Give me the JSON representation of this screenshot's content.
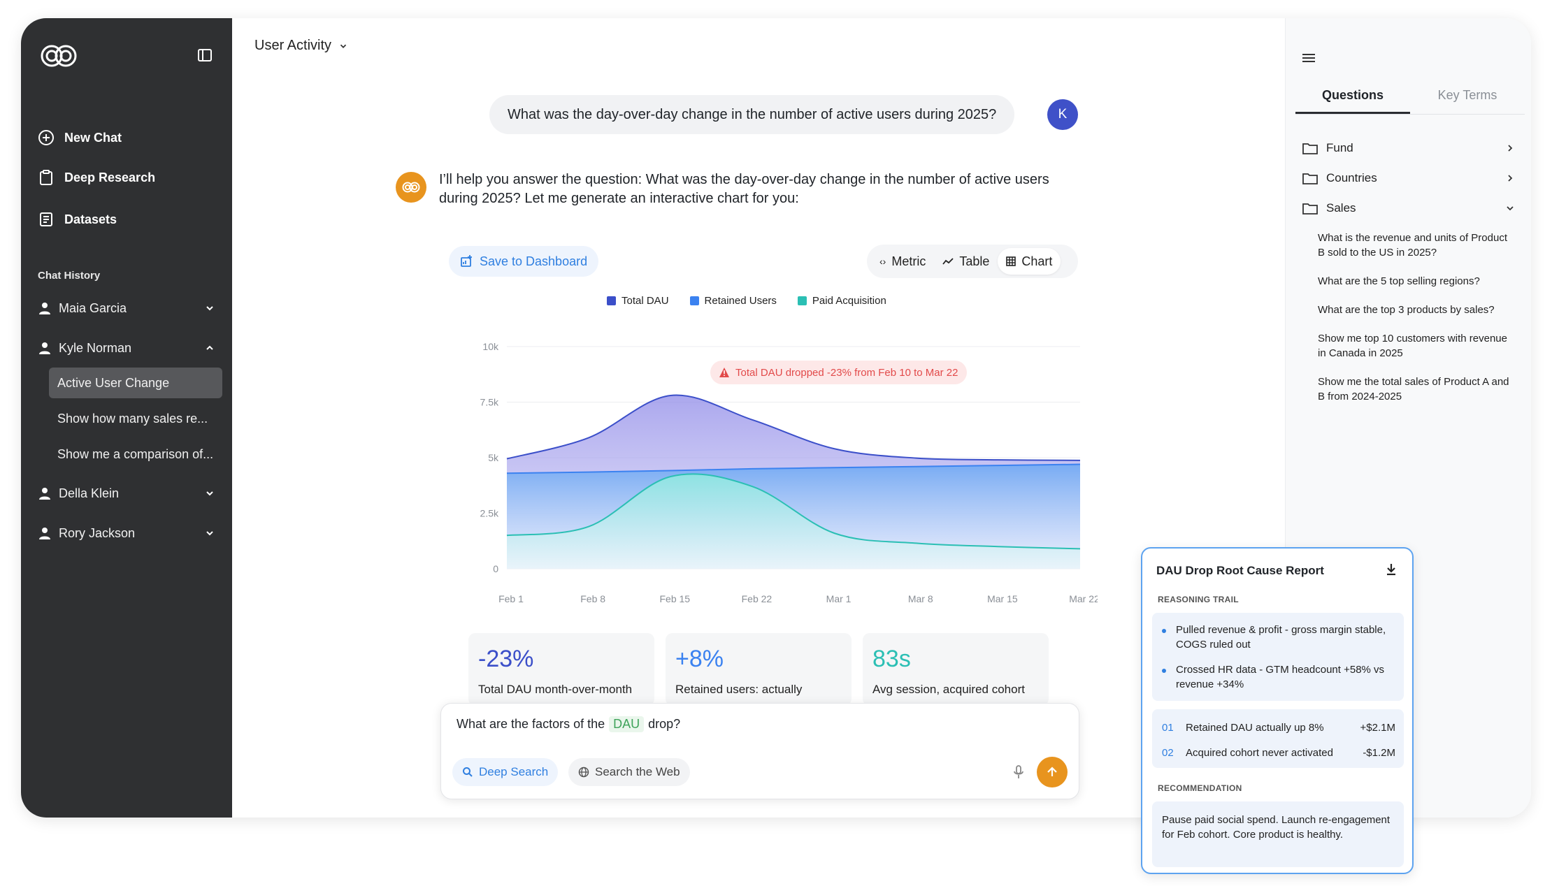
{
  "sidebar": {
    "nav": [
      {
        "label": "New Chat"
      },
      {
        "label": "Deep Research"
      },
      {
        "label": "Datasets"
      }
    ],
    "history_title": "Chat History",
    "users": [
      {
        "name": "Maia Garcia"
      },
      {
        "name": "Kyle Norman"
      },
      {
        "name": "Della Klein"
      },
      {
        "name": "Rory Jackson"
      }
    ],
    "kyle_chats": [
      {
        "label": "Active User Change"
      },
      {
        "label": "Show how many sales re..."
      },
      {
        "label": "Show me a comparison of..."
      }
    ]
  },
  "header": {
    "title": "User Activity"
  },
  "chat": {
    "user_message": "What was the day-over-day change in the number of active users during 2025?",
    "user_avatar": "K",
    "bot_message": "I’ll help you answer the question: What was the day-over-day change in the number of active users during 2025? Let me generate an interactive chart for you:"
  },
  "toolbar": {
    "save_label": "Save to Dashboard",
    "views": [
      {
        "label": "Metric"
      },
      {
        "label": "Table"
      },
      {
        "label": "Chart"
      }
    ],
    "selected_view": "Chart"
  },
  "alert": {
    "text": "Total DAU dropped -23% from Feb 10 to Mar 22"
  },
  "chart_data": {
    "type": "area",
    "x": [
      "Feb 1",
      "Feb 8",
      "Feb 15",
      "Feb 22",
      "Mar 1",
      "Mar 8",
      "Mar 15",
      "Mar 22"
    ],
    "ylim": [
      0,
      10000
    ],
    "yticks": [
      "10k",
      "7.5k",
      "5k",
      "2.5k",
      "0"
    ],
    "legend_position": "top-center",
    "grid": true,
    "series": [
      {
        "name": "Total DAU",
        "color": "#3b4fc9",
        "values": [
          4950,
          5900,
          7800,
          6700,
          5400,
          4980,
          4900,
          4880
        ]
      },
      {
        "name": "Retained Users",
        "color": "#3b82f0",
        "values": [
          4300,
          4350,
          4420,
          4500,
          4550,
          4600,
          4650,
          4700
        ]
      },
      {
        "name": "Paid Acquisition",
        "color": "#2bbfb4",
        "values": [
          1500,
          1900,
          4150,
          3700,
          1600,
          1150,
          1000,
          900
        ]
      }
    ]
  },
  "metrics": [
    {
      "value": "-23%",
      "label": "Total DAU month-over-month",
      "color": "#3b4fc9"
    },
    {
      "value": "+8%",
      "label": "Retained users: actually",
      "color": "#3b82f0"
    },
    {
      "value": "83s",
      "label": "Avg session, acquired cohort",
      "color": "#2bbfb4"
    }
  ],
  "input": {
    "text_before": "What are the factors of the",
    "highlight": "DAU",
    "text_after": "drop?",
    "deep_search": "Deep Search",
    "search_web": "Search the Web"
  },
  "right_panel": {
    "tabs": [
      {
        "label": "Questions"
      },
      {
        "label": "Key Terms"
      }
    ],
    "folders": [
      {
        "label": "Fund"
      },
      {
        "label": "Countries"
      },
      {
        "label": "Sales"
      }
    ],
    "questions": [
      {
        "text": "What is the revenue and units of Product B sold to the US in 2025?"
      },
      {
        "text": "What are the 5 top selling regions?"
      },
      {
        "text": "What are the top 3 products by sales?"
      },
      {
        "text": "Show me top 10 customers with revenue in Canada in 2025"
      },
      {
        "text": "Show me the total sales of Product A and B from 2024-2025"
      }
    ]
  },
  "report": {
    "title": "DAU Drop Root Cause Report",
    "reasoning_title": "REASONING TRAIL",
    "reasoning": [
      {
        "text": "Pulled revenue & profit - gross margin stable, COGS ruled out"
      },
      {
        "text": "Crossed HR data - GTM headcount +58% vs revenue +34%"
      }
    ],
    "findings": [
      {
        "num": "01",
        "text": "Retained DAU actually up 8%",
        "amount": "+$2.1M"
      },
      {
        "num": "02",
        "text": "Acquired cohort never activated",
        "amount": "-$1.2M"
      }
    ],
    "recommendation_title": "RECOMMENDATION",
    "recommendation": "Pause paid social spend. Launch re-engagement for Feb cohort. Core product is healthy."
  }
}
